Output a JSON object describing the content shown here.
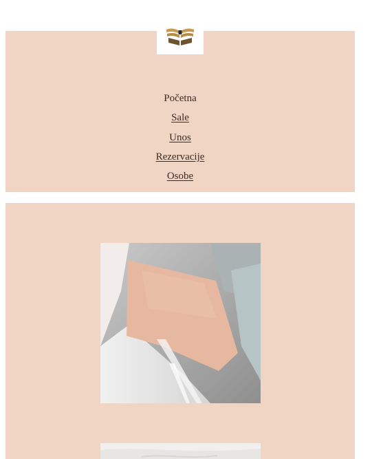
{
  "site": {
    "logo_icon": "open-book-wings-logo"
  },
  "nav": {
    "items": [
      {
        "label": "Početna",
        "current": true
      },
      {
        "label": "Sale"
      },
      {
        "label": "Unos"
      },
      {
        "label": "Rezervacije"
      },
      {
        "label": "Osobe"
      }
    ]
  },
  "colors": {
    "panel": "#f0d5c5",
    "text": "#3a2a22",
    "art_paint": "#e7b8a0"
  },
  "content": {
    "images": [
      "abstract-painted-wall-image",
      "plaster-wall-image"
    ]
  }
}
